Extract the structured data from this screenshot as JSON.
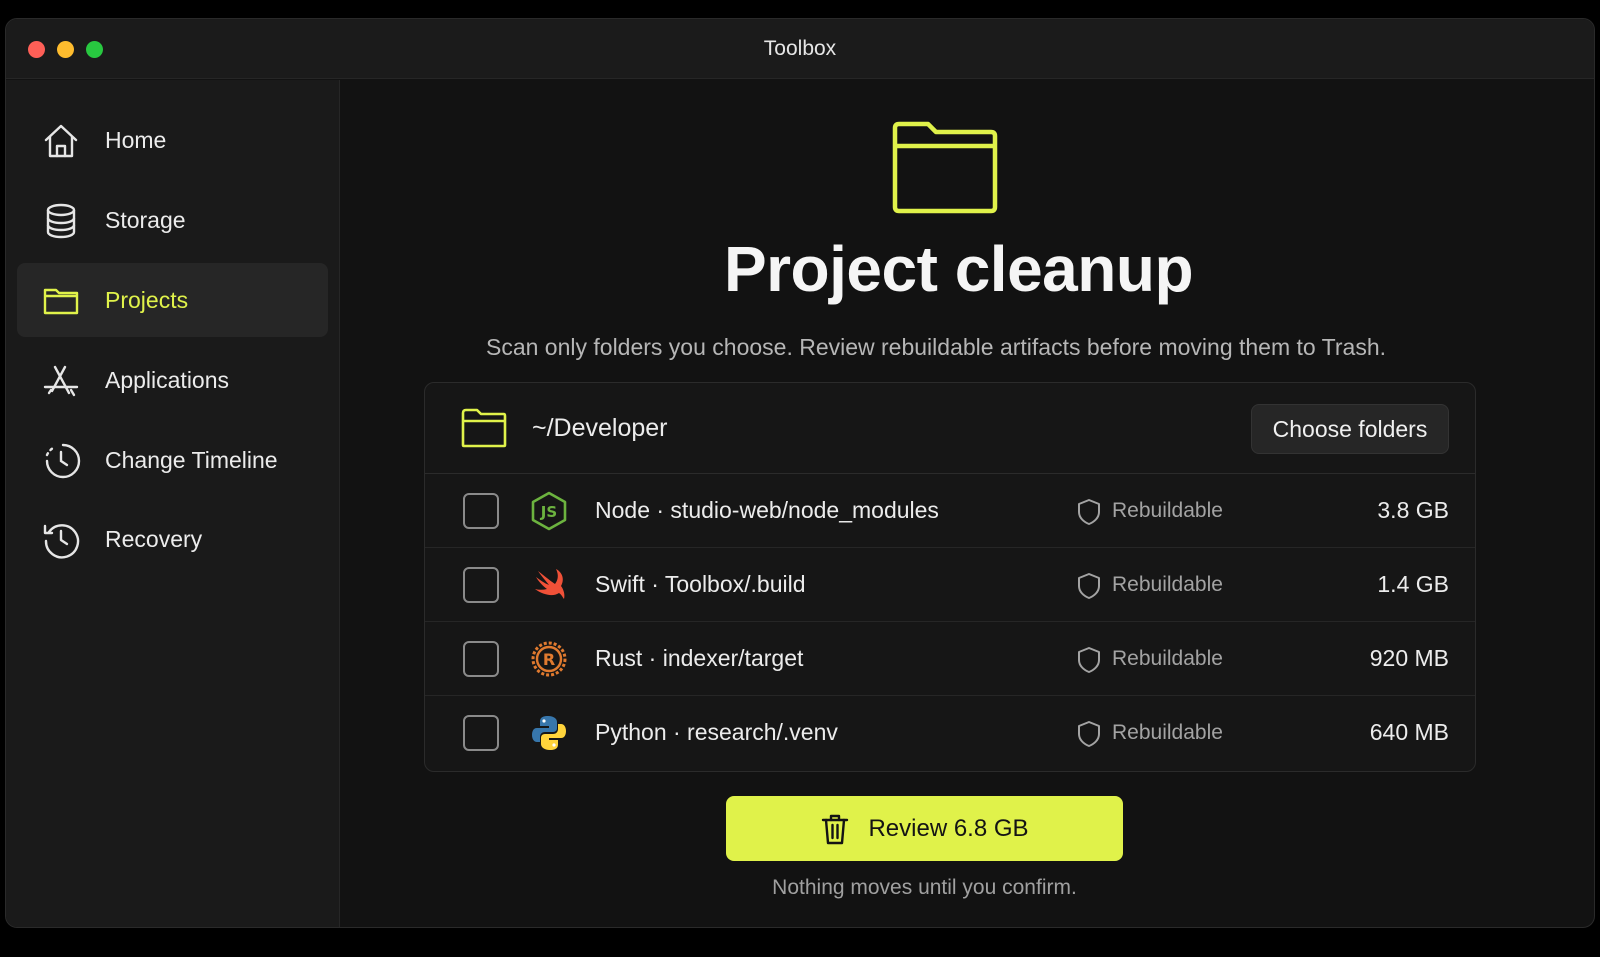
{
  "window": {
    "title": "Toolbox"
  },
  "sidebar": {
    "items": [
      {
        "label": "Home",
        "icon": "home-icon",
        "active": false
      },
      {
        "label": "Storage",
        "icon": "database-icon",
        "active": false
      },
      {
        "label": "Projects",
        "icon": "folder-icon",
        "active": true
      },
      {
        "label": "Applications",
        "icon": "app-store-icon",
        "active": false
      },
      {
        "label": "Change Timeline",
        "icon": "clock-icon",
        "active": false
      },
      {
        "label": "Recovery",
        "icon": "history-icon",
        "active": false
      }
    ]
  },
  "main": {
    "title": "Project cleanup",
    "subtitle": "Scan only folders you choose. Review rebuildable artifacts before moving them to Trash.",
    "folder_path": "~/Developer",
    "choose_button": "Choose folders",
    "rows": [
      {
        "label": "Node · studio-web/node_modules",
        "icon": "nodejs-icon",
        "status": "Rebuildable",
        "size": "3.8 GB",
        "checked": false
      },
      {
        "label": "Swift · Toolbox/.build",
        "icon": "swift-icon",
        "status": "Rebuildable",
        "size": "1.4 GB",
        "checked": false
      },
      {
        "label": "Rust · indexer/target",
        "icon": "rust-icon",
        "status": "Rebuildable",
        "size": "920 MB",
        "checked": false
      },
      {
        "label": "Python · research/.venv",
        "icon": "python-icon",
        "status": "Rebuildable",
        "size": "640 MB",
        "checked": false
      }
    ],
    "review_button": "Review 6.8 GB",
    "footnote": "Nothing moves until you confirm."
  },
  "colors": {
    "accent": "#e0f24a",
    "background": "#121212",
    "sidebar": "#1a1a1a",
    "node": "#6cb33f",
    "swift": "#f05138",
    "rust": "#e07a2f",
    "python_blue": "#3776ab",
    "python_yellow": "#ffd43b"
  }
}
